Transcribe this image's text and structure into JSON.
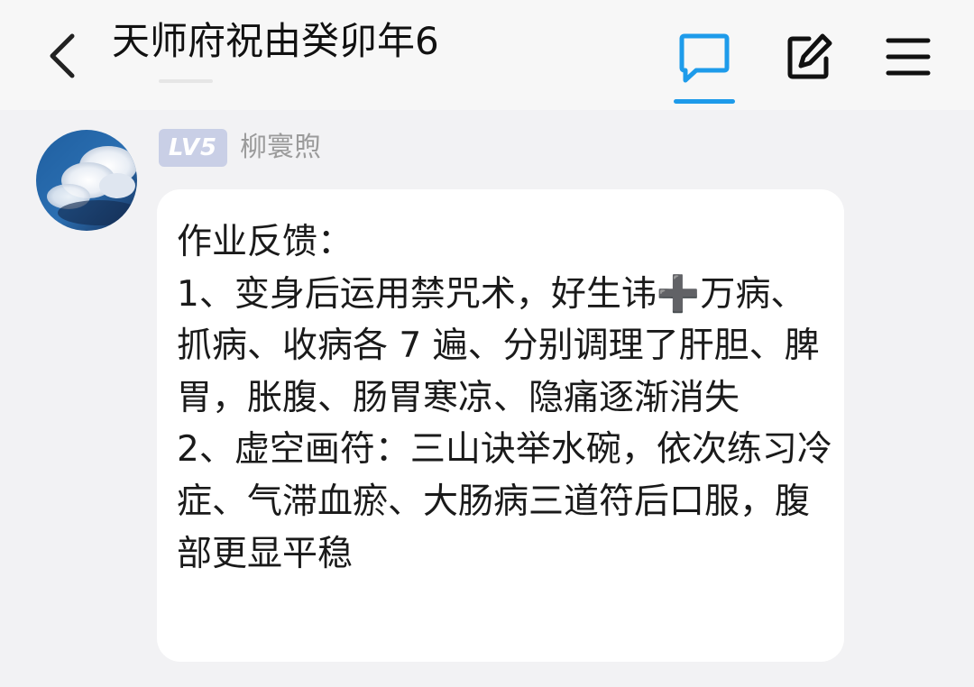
{
  "header": {
    "title": "天师府祝由癸卯年6",
    "icons": {
      "back": "chevron-left-icon",
      "comment": "comment-icon",
      "edit": "edit-icon",
      "menu": "menu-icon"
    },
    "accent_color": "#1e9bea"
  },
  "post": {
    "level_badge": "LV5",
    "username": "柳寰煦",
    "body": "作业反馈：\n1、变身后运用禁咒术，好生讳➕万病、抓病、收病各 7 遍、分别调理了肝胆、脾胃，胀腹、肠胃寒凉、隐痛逐渐消失\n2、虚空画符：三山诀举水碗，依次练习冷症、气滞血瘀、大肠病三道符后口服，腹部更显平稳"
  }
}
